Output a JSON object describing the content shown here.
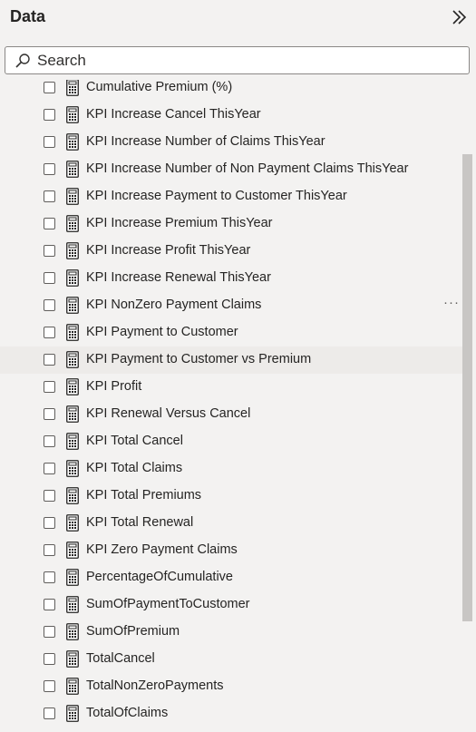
{
  "header": {
    "title": "Data"
  },
  "search": {
    "placeholder": "Search"
  },
  "fields": [
    {
      "label": "Cumulative Premium (%)"
    },
    {
      "label": "KPI Increase Cancel ThisYear"
    },
    {
      "label": "KPI Increase Number of Claims ThisYear"
    },
    {
      "label": "KPI Increase Number of Non Payment Claims ThisYear"
    },
    {
      "label": "KPI Increase Payment to Customer ThisYear"
    },
    {
      "label": "KPI Increase Premium ThisYear"
    },
    {
      "label": "KPI Increase Profit ThisYear"
    },
    {
      "label": "KPI Increase Renewal ThisYear"
    },
    {
      "label": "KPI NonZero Payment Claims",
      "more": "···"
    },
    {
      "label": "KPI Payment to Customer"
    },
    {
      "label": "KPI Payment to Customer vs Premium"
    },
    {
      "label": "KPI Profit"
    },
    {
      "label": "KPI Renewal Versus Cancel"
    },
    {
      "label": "KPI Total Cancel"
    },
    {
      "label": "KPI Total Claims"
    },
    {
      "label": "KPI Total Premiums"
    },
    {
      "label": "KPI Total Renewal"
    },
    {
      "label": "KPI Zero Payment Claims"
    },
    {
      "label": "PercentageOfCumulative"
    },
    {
      "label": "SumOfPaymentToCustomer"
    },
    {
      "label": "SumOfPremium"
    },
    {
      "label": "TotalCancel"
    },
    {
      "label": "TotalNonZeroPayments"
    },
    {
      "label": "TotalOfClaims"
    }
  ],
  "icons": {
    "collapse": "double-chevron-right-icon",
    "search": "search-icon",
    "field": "calculator-icon"
  },
  "colors": {
    "pane_background": "#f3f2f1",
    "hover_row": "#edebe9",
    "scrollbar": "#c8c6c4",
    "text": "#252423"
  }
}
